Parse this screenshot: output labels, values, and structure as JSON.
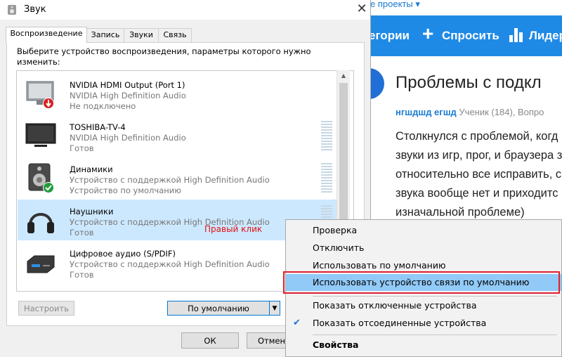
{
  "web": {
    "top_link": "е проекты ▾",
    "nav": {
      "categories": "егории",
      "ask": "Спросить",
      "leaders": "Лидер"
    },
    "title": "Проблемы с подкл",
    "meta": {
      "user": "нгшдшд егшд",
      "rest": "Ученик (184), Вопро"
    },
    "body_lines": [
      "Столкнулся с проблемой, когд",
      "звуки из игр, прог, и браузера з",
      "относительно все исправить, с",
      "звука вообще нет и приходитс",
      "изначальной проблеме)"
    ]
  },
  "dialog": {
    "title": "Звук",
    "tabs": [
      "Воспроизведение",
      "Запись",
      "Звуки",
      "Связь"
    ],
    "instructions": "Выберите устройство воспроизведения, параметры которого нужно изменить:",
    "devices": [
      {
        "name": "NVIDIA HDMI Output (Port 1)",
        "desc": "NVIDIA High Definition Audio",
        "status": "Не подключено",
        "icon": "monitor-disconnected-icon"
      },
      {
        "name": "TOSHIBA-TV-4",
        "desc": "NVIDIA High Definition Audio",
        "status": "Готов",
        "icon": "tv-icon"
      },
      {
        "name": "Динамики",
        "desc": "Устройство с поддержкой High Definition Audio",
        "status": "Устройство по умолчанию",
        "icon": "speaker-default-icon"
      },
      {
        "name": "Наушники",
        "desc": "Устройство с поддержкой High Definition Audio",
        "status": "Готов",
        "icon": "headphones-icon"
      },
      {
        "name": "Цифровое аудио (S/PDIF)",
        "desc": "Устройство с поддержкой High Definition Audio",
        "status": "Готов",
        "icon": "digital-audio-icon"
      }
    ],
    "right_click_hint": "Правый клик",
    "buttons": {
      "configure": "Настроить",
      "default": "По умолчанию",
      "ok": "ОК",
      "cancel": "Отмен"
    }
  },
  "context_menu": {
    "items": [
      "Проверка",
      "Отключить",
      "Использовать по умолчанию",
      "Использовать устройство связи по умолчанию",
      "Показать отключенные устройства",
      "Показать отсоединенные устройства",
      "Свойства"
    ],
    "highlight_color": "#91c9f7",
    "annotation_color": "#e0202e"
  }
}
